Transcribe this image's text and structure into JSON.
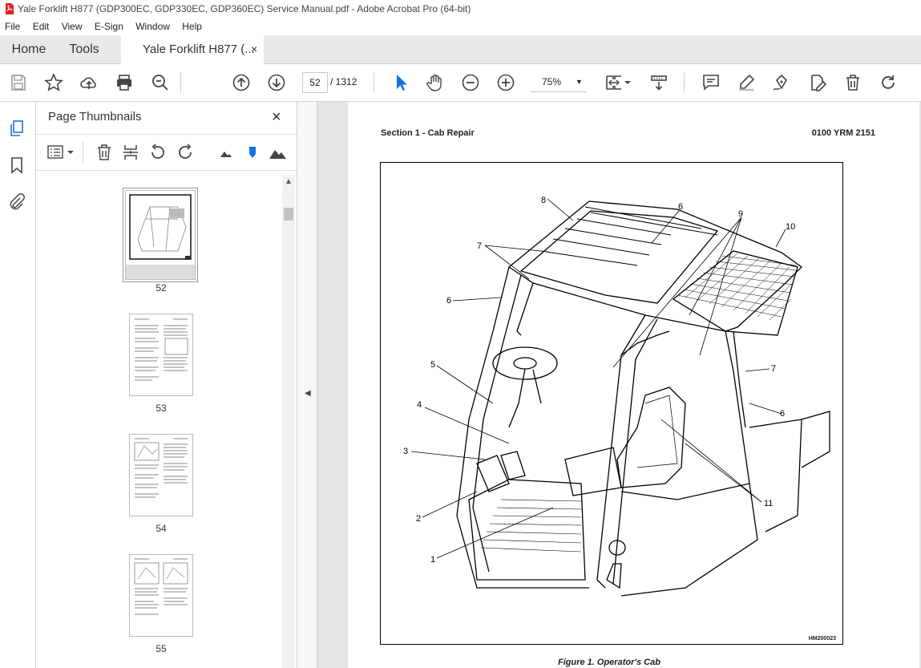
{
  "window": {
    "title": "Yale Forklift H877 (GDP300EC, GDP330EC, GDP360EC) Service Manual.pdf - Adobe Acrobat Pro (64-bit)"
  },
  "menu": [
    "File",
    "Edit",
    "View",
    "E-Sign",
    "Window",
    "Help"
  ],
  "tabs": {
    "home": "Home",
    "tools": "Tools",
    "doc": "Yale Forklift H877 (...",
    "close": "×"
  },
  "toolbar": {
    "current_page": "52",
    "page_total": "/ 1312",
    "zoom": "75%",
    "zoom_caret": "▼"
  },
  "panel": {
    "title": "Page Thumbnails",
    "close": "×",
    "thumbnails": [
      {
        "label": "52",
        "selected": true,
        "progress": 0.04
      },
      {
        "label": "53"
      },
      {
        "label": "54"
      },
      {
        "label": "55"
      }
    ]
  },
  "document": {
    "header_left": "Section 1 - Cab Repair",
    "header_right": "0100 YRM 2151",
    "figure_code": "HM200023",
    "caption": "Figure 1. Operator's Cab",
    "callouts": [
      "8",
      "6",
      "9",
      "10",
      "7",
      "6",
      "7",
      "5",
      "4",
      "3",
      "2",
      "1",
      "6",
      "11"
    ]
  },
  "colors": {
    "accent": "#1473e6",
    "tabbar": "#e9e9e9",
    "docbg": "#e5e5e5"
  }
}
